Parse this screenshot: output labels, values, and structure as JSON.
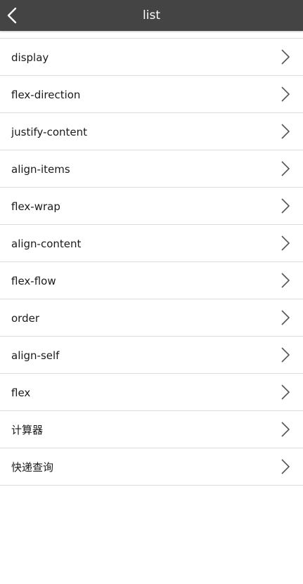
{
  "header": {
    "title": "list",
    "back_icon": "chevron-left-icon",
    "background": "#444444",
    "text_color": "#ffffff"
  },
  "list": {
    "chevron_icon": "chevron-right-icon",
    "items": [
      {
        "label": "display"
      },
      {
        "label": "flex-direction"
      },
      {
        "label": "justify-content"
      },
      {
        "label": "align-items"
      },
      {
        "label": "flex-wrap"
      },
      {
        "label": "align-content"
      },
      {
        "label": "flex-flow"
      },
      {
        "label": "order"
      },
      {
        "label": "align-self"
      },
      {
        "label": "flex"
      },
      {
        "label": "计算器"
      },
      {
        "label": "快递查询"
      }
    ]
  }
}
